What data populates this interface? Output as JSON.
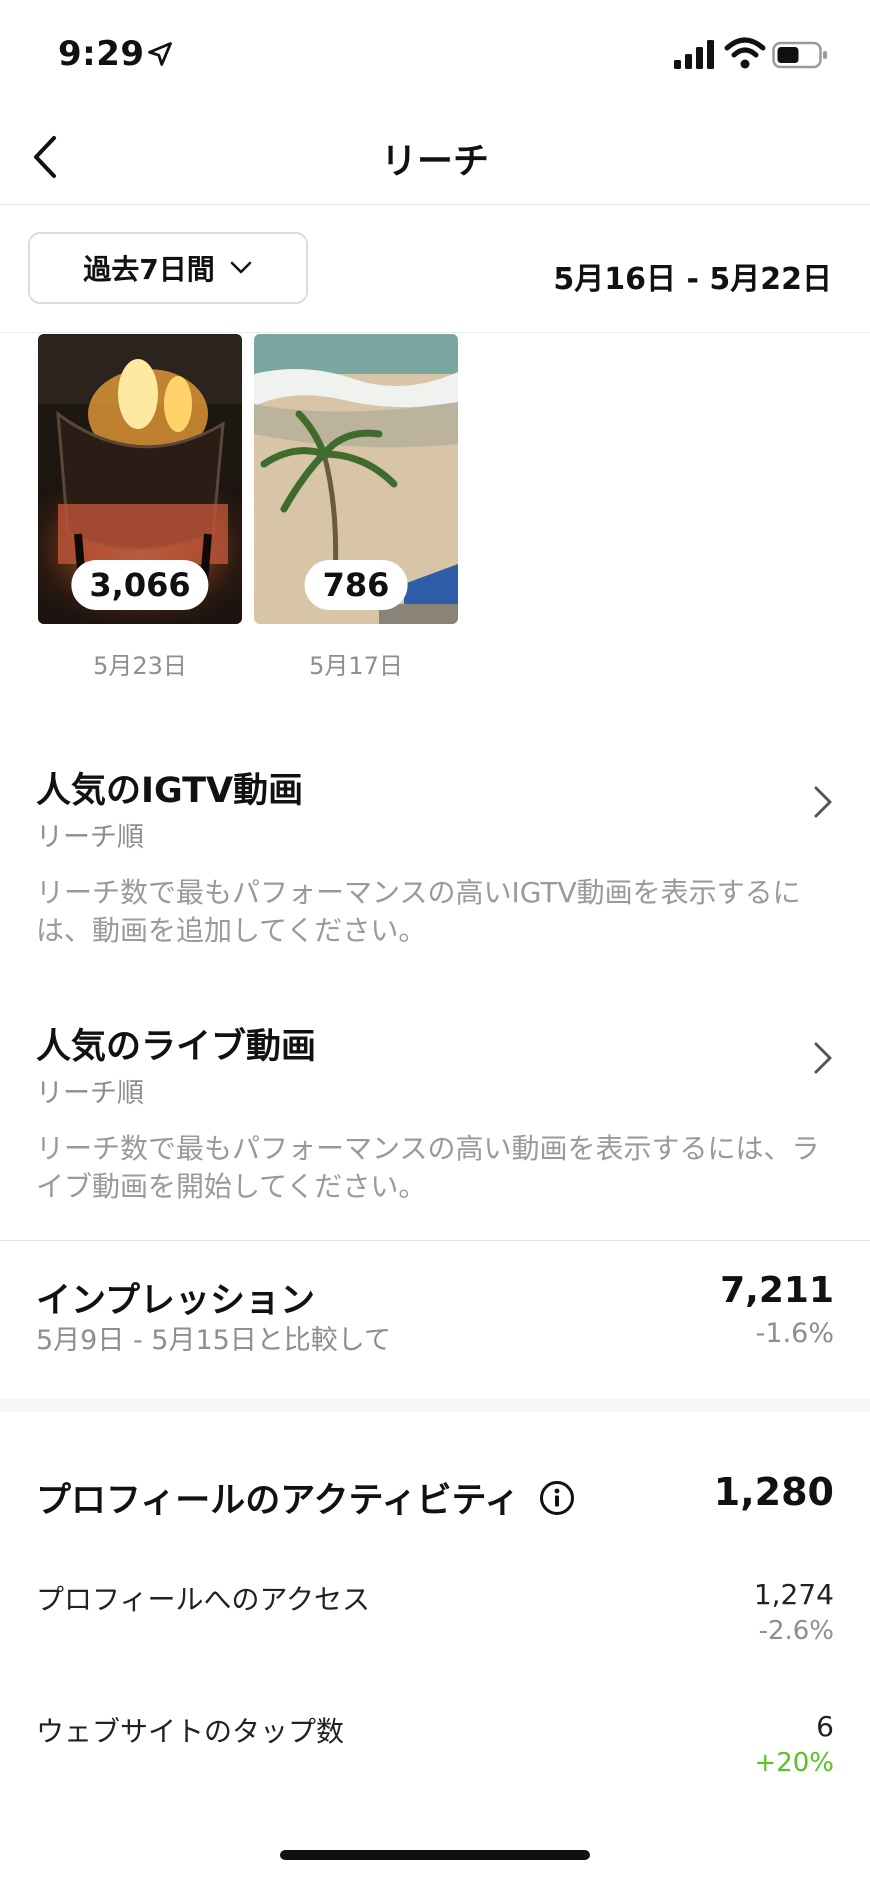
{
  "status_bar": {
    "time": "9:29"
  },
  "nav": {
    "title": "リーチ"
  },
  "filter": {
    "period_label": "過去7日間",
    "date_range": "5月16日 - 5月22日"
  },
  "stories": [
    {
      "count": "3,066",
      "date": "5月23日"
    },
    {
      "count": "786",
      "date": "5月17日"
    }
  ],
  "igtv": {
    "title": "人気のIGTV動画",
    "subtitle": "リーチ順",
    "description": "リーチ数で最もパフォーマンスの高いIGTV動画を表示するには、動画を追加してください。"
  },
  "live": {
    "title": "人気のライブ動画",
    "subtitle": "リーチ順",
    "description": "リーチ数で最もパフォーマンスの高い動画を表示するには、ライブ動画を開始してください。"
  },
  "impressions": {
    "title": "インプレッション",
    "comparison": "5月9日 - 5月15日と比較して",
    "value": "7,211",
    "change": "-1.6%"
  },
  "profile_activity": {
    "title": "プロフィールのアクティビティ",
    "value": "1,280",
    "metrics": [
      {
        "label": "プロフィールへのアクセス",
        "value": "1,274",
        "change": "-2.6%",
        "change_color": "#8e8e8e"
      },
      {
        "label": "ウェブサイトのタップ数",
        "value": "6",
        "change": "+20%",
        "change_color": "#58c322"
      }
    ]
  }
}
